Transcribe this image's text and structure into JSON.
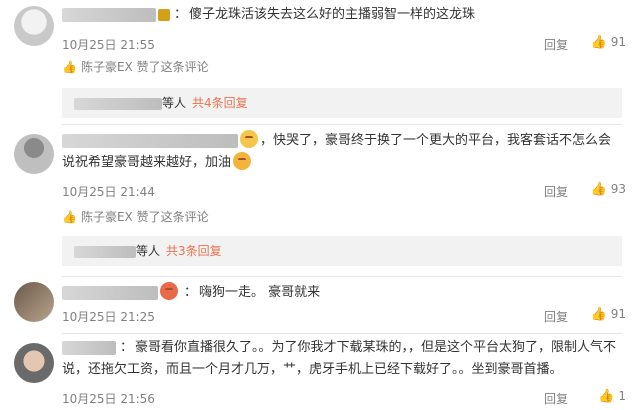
{
  "comments": [
    {
      "text": "傻子龙珠活该失去这么好的主播弱智一样的这龙珠",
      "date": "10月25日 21:55",
      "reply": "回复",
      "likes": "91",
      "praise": "陈子豪EX 赞了这条评论",
      "sub_names": "等人",
      "sub_more": "共4条回复"
    },
    {
      "text_part1": "，快哭了，豪哥终于换了一个更大的平台，我客套话不怎么会",
      "text_part2": "说祝希望豪哥越来越好，加油",
      "date": "10月25日 21:44",
      "reply": "回复",
      "likes": "93",
      "praise": "陈子豪EX 赞了这条评论",
      "sub_names": "等人",
      "sub_more": "共3条回复"
    },
    {
      "text": "嗨狗一走。 豪哥就来",
      "date": "10月25日 21:25",
      "reply": "回复",
      "likes": "91"
    },
    {
      "text_part1": "豪哥看你直播很久了。。为了你我才下载某珠的，，但是这个平台太狗了，限制人气不",
      "text_part2": "说，还拖欠工资，而且一个月才几万，艹，虎牙手机上已经下载好了。。坐到豪哥首播。",
      "date": "10月25日 21:56",
      "reply": "回复",
      "likes": "1"
    }
  ],
  "icons": {
    "like": "thumbs-up-icon",
    "praise": "thumbs-up-outline-icon",
    "emoji": "emoji-icon"
  },
  "colors": {
    "accent": "#eb7350",
    "meta": "#808080"
  }
}
